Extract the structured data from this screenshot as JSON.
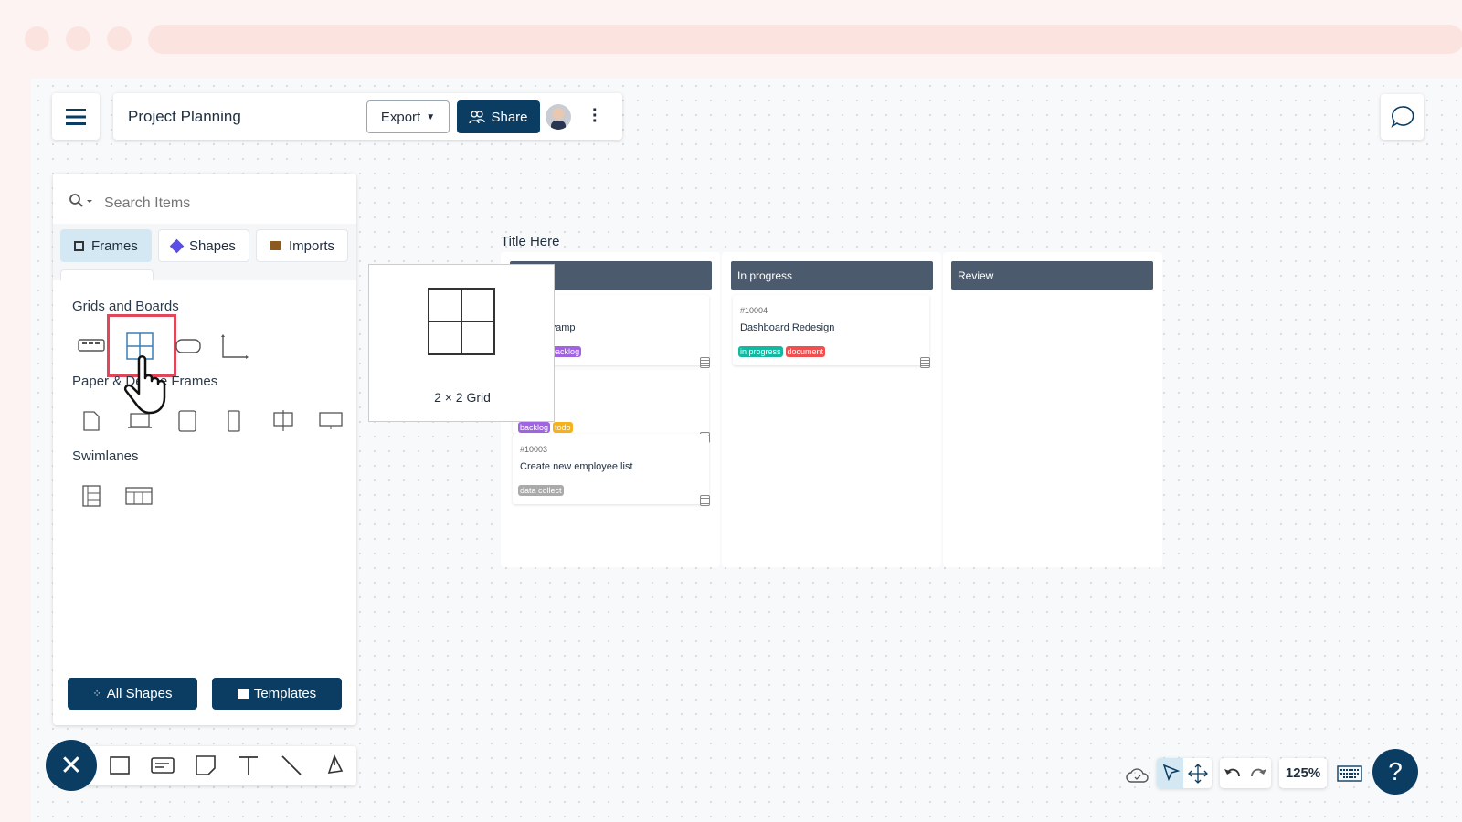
{
  "header": {
    "title": "Project Planning",
    "export_label": "Export",
    "share_label": "Share"
  },
  "panel": {
    "search_placeholder": "Search Items",
    "tabs": [
      {
        "label": "Frames",
        "active": true
      },
      {
        "label": "Shapes"
      },
      {
        "label": "Imports"
      }
    ],
    "sections": [
      {
        "title": "Grids and Boards"
      },
      {
        "title": "Paper & Device Frames"
      },
      {
        "title": "Swimlanes"
      }
    ],
    "all_shapes_label": "All Shapes",
    "templates_label": "Templates"
  },
  "tooltip": {
    "label": "2 × 2 Grid"
  },
  "board": {
    "title": "Title Here",
    "columns": [
      {
        "title": ""
      },
      {
        "title": "In progress"
      },
      {
        "title": "Review"
      }
    ],
    "tasks": [
      {
        "name": "nnel revamp",
        "tags": [
          "t",
          "todo",
          "backlog"
        ]
      },
      {
        "tags": [
          "backlog",
          "todo"
        ]
      },
      {
        "id": "#10003",
        "name": "Create new employee list",
        "tags": [
          "data collect"
        ]
      },
      {
        "id": "#10004",
        "name": "Dashboard Redesign",
        "tags": [
          "in progress",
          "document"
        ]
      }
    ]
  },
  "bottom": {
    "zoom": "125%",
    "help": "?"
  },
  "colors": {
    "primary": "#0b3d63",
    "highlight": "#e0475b",
    "column_header": "#4b5b6d",
    "tag_backlog": "#a064e0",
    "tag_todo": "#f5b21c",
    "tag_inprogress": "#14b8a0",
    "tag_document": "#ee5050",
    "tag_data": "#aaaaaa"
  }
}
